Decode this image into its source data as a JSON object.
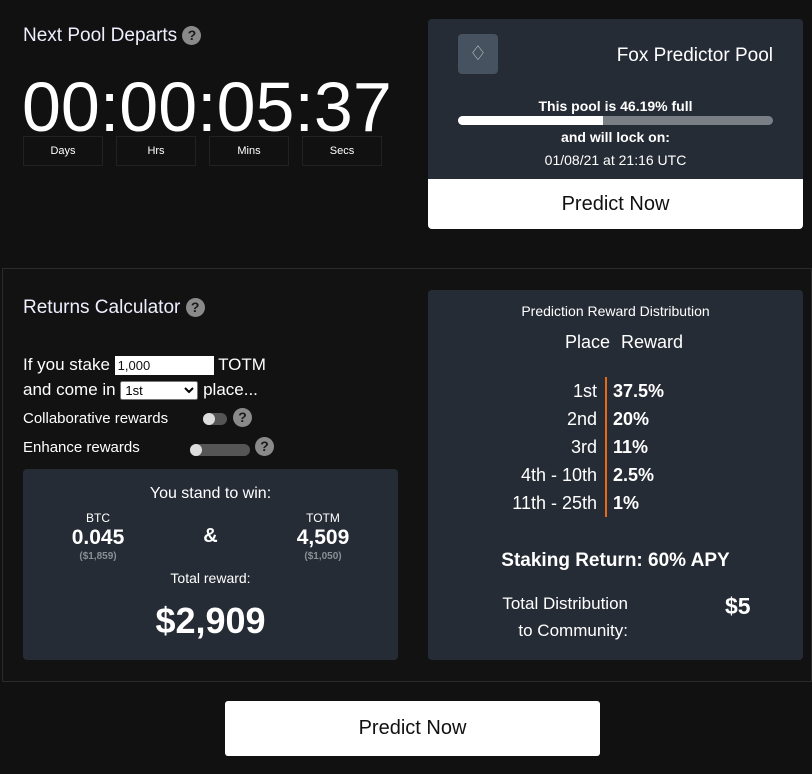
{
  "countdown": {
    "title": "Next Pool Departs",
    "help": "?",
    "time": "00:00:05:37",
    "units": [
      "Days",
      "Hrs",
      "Mins",
      "Secs"
    ]
  },
  "pool": {
    "icon": "fox-logo",
    "name": "Fox Predictor Pool",
    "fill_text": "This pool is 46.19% full",
    "fill_percent": 46.19,
    "lock_text": "and will lock on:",
    "lock_date": "01/08/21 at 21:16 UTC",
    "button": "Predict Now"
  },
  "calculator": {
    "title": "Returns Calculator",
    "help": "?",
    "stake_prefix": "If you stake",
    "stake_value": "1,000",
    "stake_unit": "TOTM",
    "place_prefix": "and come in",
    "place_value": "1st",
    "place_suffix": "place...",
    "collab_label": "Collaborative rewards",
    "collab_on": false,
    "enhance_label": "Enhance rewards",
    "enhance_on": false,
    "win": {
      "title": "You stand to win:",
      "btc_label": "BTC",
      "btc_value": "0.045",
      "btc_usd": "($1,859)",
      "amp": "&",
      "totm_label": "TOTM",
      "totm_value": "4,509",
      "totm_usd": "($1,050)",
      "total_label": "Total reward:",
      "total_value": "$2,909"
    }
  },
  "distribution": {
    "title": "Prediction Reward Distribution",
    "col_place": "Place",
    "col_reward": "Reward",
    "rows": [
      {
        "place": "1st",
        "reward": "37.5%"
      },
      {
        "place": "2nd",
        "reward": "20%"
      },
      {
        "place": "3rd",
        "reward": "11%"
      },
      {
        "place": "4th - 10th",
        "reward": "2.5%"
      },
      {
        "place": "11th - 25th",
        "reward": "1%"
      }
    ],
    "staking": "Staking Return: 60% APY",
    "total_label_1": "Total Distribution",
    "total_label_2": "to Community:",
    "total_value": "$5",
    "accent": "#e86a17"
  },
  "bottom_button": "Predict Now"
}
